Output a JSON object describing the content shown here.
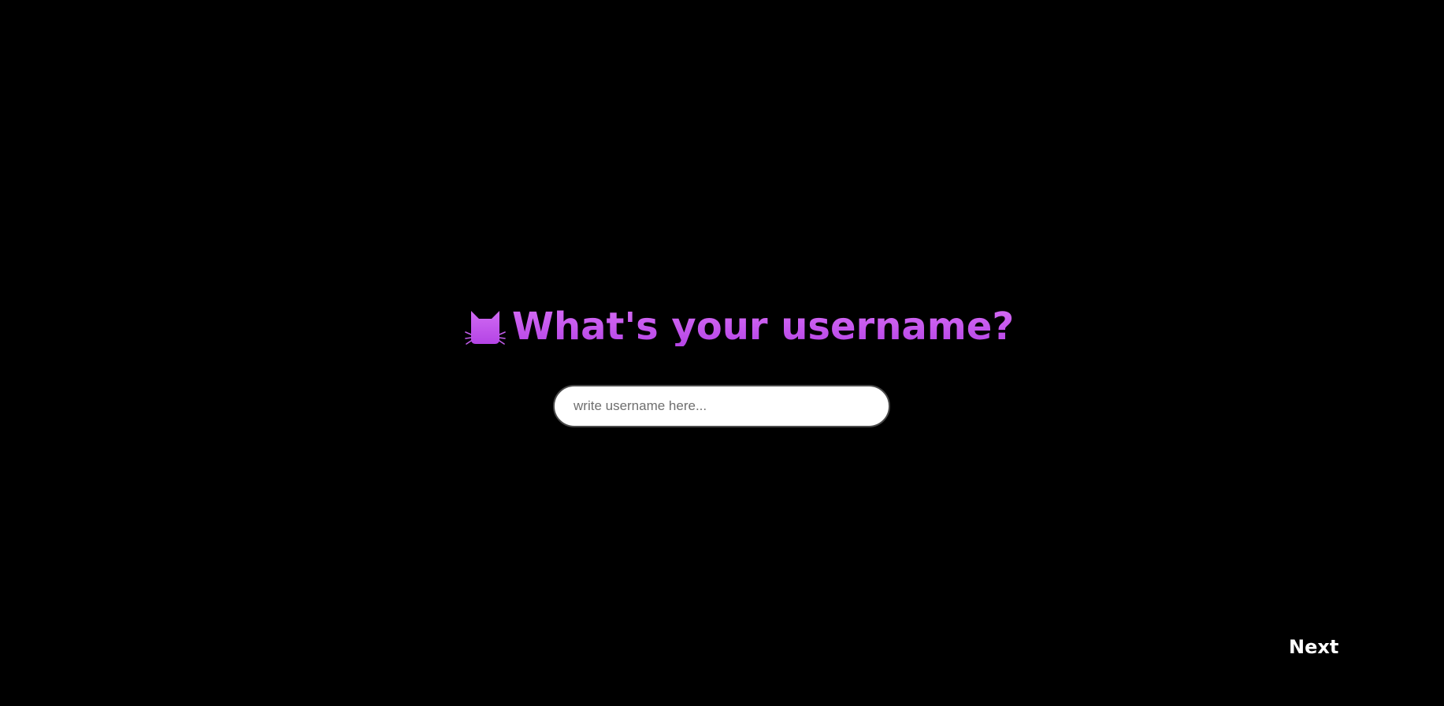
{
  "heading": {
    "text": "What's your username?",
    "icon": "cat-face-icon",
    "gradient_top": "#d66cf5",
    "gradient_bottom": "#b645e6"
  },
  "username_field": {
    "value": "",
    "placeholder": "write username here..."
  },
  "navigation": {
    "next_label": "Next"
  },
  "colors": {
    "background": "#000000",
    "accent": "#c25bea",
    "button_text": "#ffffff"
  }
}
